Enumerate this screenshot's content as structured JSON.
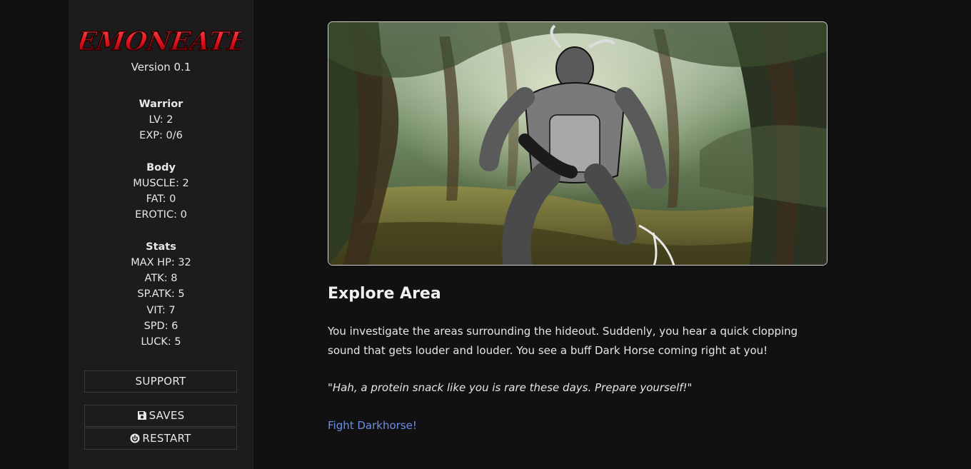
{
  "sidebar": {
    "logo_text": "DEMONEATER",
    "version": "Version 0.1",
    "class_block": {
      "heading": "Warrior",
      "lv": "LV: 2",
      "exp": "EXP: 0/6"
    },
    "body_block": {
      "heading": "Body",
      "muscle": "MUSCLE: 2",
      "fat": "FAT: 0",
      "erotic": "EROTIC: 0"
    },
    "stats_block": {
      "heading": "Stats",
      "max_hp": "MAX HP: 32",
      "atk": "ATK: 8",
      "sp_atk": "SP.ATK: 5",
      "vit": "VIT: 7",
      "spd": "SPD: 6",
      "luck": "LUCK: 5"
    },
    "buttons": {
      "support": "SUPPORT",
      "saves": "SAVES",
      "restart": "RESTART"
    }
  },
  "passage": {
    "title": "Explore Area",
    "paragraph": "You investigate the areas surrounding the hideout. Suddenly, you hear a quick clopping sound that gets louder and louder. You see a buff Dark Horse coming right at you!",
    "quote": "\"Hah, a protein snack like you is rare these days. Prepare yourself!\"",
    "link": "Fight Darkhorse!"
  },
  "colors": {
    "background": "#111111",
    "sidebar": "#1c1c1c",
    "link": "#6c8fe3",
    "logo_red": "#e0202a"
  },
  "icons": {
    "saves": "floppy-disk-icon",
    "restart": "power-icon"
  }
}
